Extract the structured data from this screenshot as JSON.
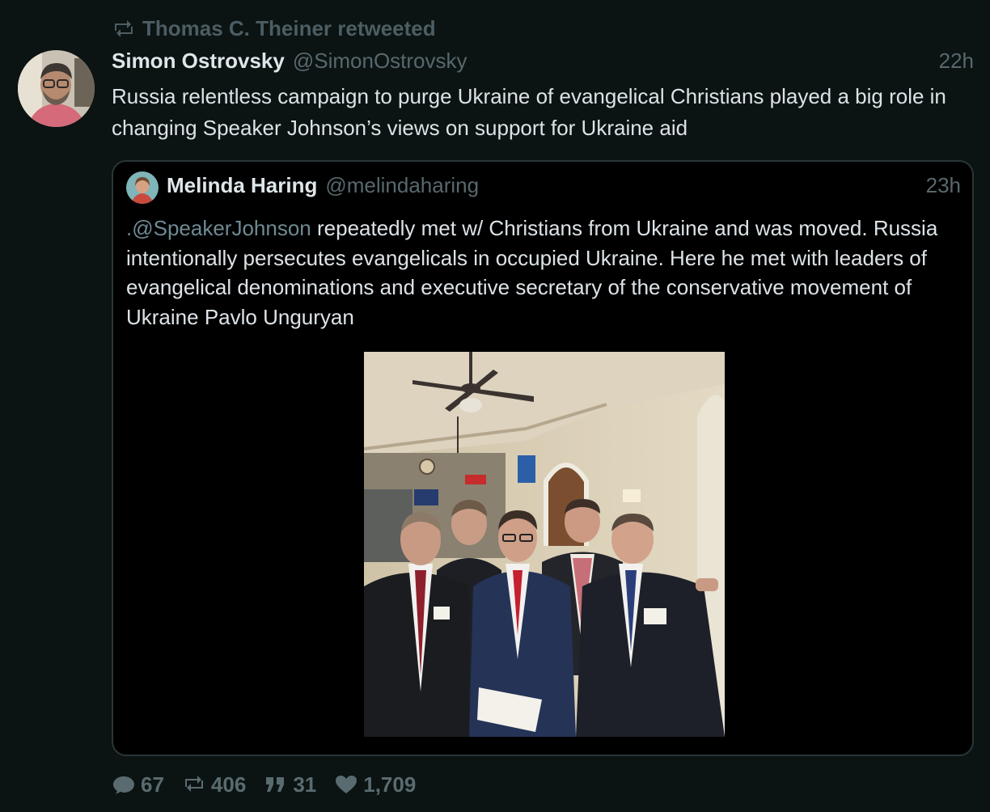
{
  "retweet": {
    "label": "Thomas C. Theiner retweeted"
  },
  "tweet": {
    "author_name": "Simon Ostrovsky",
    "author_handle": "@SimonOstrovsky",
    "time": "22h",
    "text": "Russia relentless campaign to purge Ukraine of evangelical Christians played a big role in changing Speaker Johnson’s views on support for Ukraine aid"
  },
  "quote": {
    "author_name": "Melinda Haring",
    "author_handle": "@melindaharing",
    "time": "23h",
    "mention": ".@SpeakerJohnson",
    "text": " repeatedly met w/ Christians from Ukraine and was moved. Russia intentionally persecutes evangelicals in occupied Ukraine. Here he met with leaders of evangelical denominations and executive secretary of the conservative movement of Ukraine Pavlo Unguryan"
  },
  "actions": {
    "replies": "67",
    "retweets": "406",
    "quotes": "31",
    "likes": "1,709"
  },
  "colors": {
    "background": "#0b1313",
    "muted": "#58686d",
    "text": "#dce3e7",
    "border": "#2a3638"
  }
}
